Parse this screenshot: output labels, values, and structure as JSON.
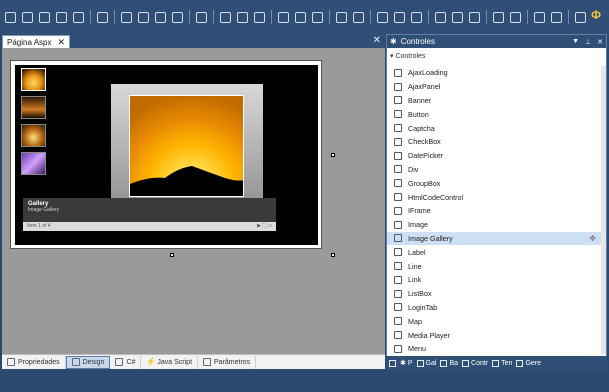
{
  "document": {
    "tab_title": "Página Aspx",
    "tab_close": "✕",
    "close": "✕",
    "gallery": {
      "caption_title": "Gallery",
      "caption_subtitle": "Image Gallery",
      "pager_text": "Item 1 of 4"
    }
  },
  "bottom_tabs": [
    {
      "label": "Propriedades"
    },
    {
      "label": "Design"
    },
    {
      "label": "C#"
    },
    {
      "label": "Java Script"
    },
    {
      "label": "Parâmetros"
    }
  ],
  "panel": {
    "title": "Controles",
    "group": "Controles",
    "items": [
      "AjaxLoading",
      "AjaxPanel",
      "Banner",
      "Button",
      "Captcha",
      "CheckBox",
      "DatePicker",
      "Div",
      "GroupBox",
      "HtmlCodeControl",
      "IFrame",
      "Image",
      "Image Gallery",
      "Label",
      "Line",
      "Link",
      "ListBox",
      "LoginTab",
      "Map",
      "Media Player",
      "Menu"
    ],
    "selected": "Image Gallery",
    "bottom_tabs": [
      "P",
      "Gal",
      "Ba",
      "Contr",
      "Ten",
      "Gere"
    ]
  },
  "colors": {
    "accent": "#2f4f76",
    "selection": "#cddff2"
  }
}
